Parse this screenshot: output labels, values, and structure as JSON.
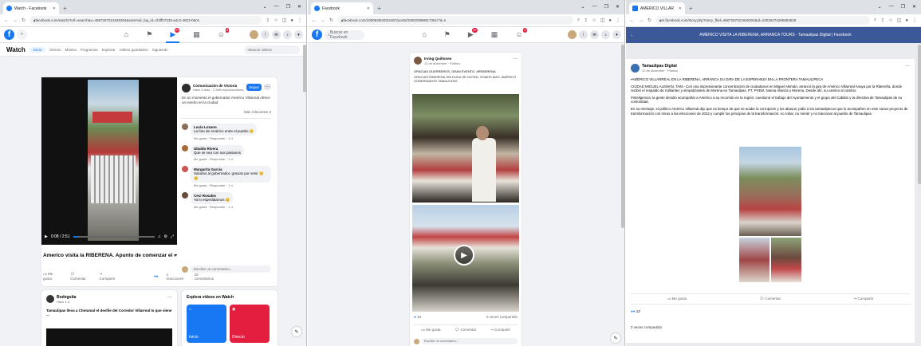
{
  "win1": {
    "tab_title": "Watch - Facebook",
    "url": "facebook.com/watch/?ref=search&v=4587257021846304&external_log_id=1f4ffb7235-a4c2-4823-b9c6",
    "watch_title": "Watch",
    "watch_tabs": [
      "Inicio",
      "Directo",
      "Música",
      "Programas",
      "Explorar",
      "Videos guardados",
      "Siguiendo"
    ],
    "search_placeholder": "Buscar videos",
    "video_time": "0:08 / 2:51",
    "video_title": "Americo visita la RIBERENA. Apunto de comenzar el evento ...",
    "actions": [
      "Me gusta",
      "Comentar",
      "Compartir"
    ],
    "reactions_count": "4 reacciones",
    "comments_count": "20 comentarios",
    "page_name": "Comunicación de Victoria",
    "page_meta": "Hace 5 días · 2 398 reproducciones",
    "follow_label": "Seguir",
    "page_desc": "En un momento el gobernador Américo Villarreal ofrece un evento en la ciudad",
    "sort_label": "Más relevantes",
    "comments": [
      {
        "name": "Lucía Lozano",
        "text": "La foto de Américo entre el pueblo"
      },
      {
        "name": "Ubaldo Rivera",
        "text": "Que se vea con sus paisanos"
      },
      {
        "name": "Margarita García",
        "text": "Saludos al gobernador, gracias por venir"
      },
      {
        "name": "Ceci Rosales",
        "text": "Ya lo esperábamos"
      }
    ],
    "comment_actions": "Me gusta · Responder · 1 d",
    "write_comment": "Escribe un comentario...",
    "post_author": "Bodeguita",
    "post_sub": "Hace 1 d",
    "post_text": "Tamaulipas lleva a Chetumal el desfile del Corredor Villarreal lo que viene ...",
    "explore_title": "Explora videos en Watch",
    "explore_cards": [
      "Inicio",
      "Directo"
    ]
  },
  "win2": {
    "tab_title": "Facebook",
    "url": "facebook.com/100063504022467/posts/329020989917381/?d=n",
    "search_placeholder": "Buscar en Facebook",
    "post_author": "Irving Quiñones",
    "post_meta": "12 de diciembre · Público",
    "post_caption": "GRACIAS GUERREROS, GRAN EVENTO. #REBERENA",
    "post_text": "GRACIAS RIBERENA SIN DUDA SE NOTAN, SOMOS MAS, AMÉRICO GOBERNADOR TAMAULIPAS",
    "reactions": "19",
    "shares": "3 veces compartido",
    "actions": [
      "Me gusta",
      "Comentar",
      "Compartir"
    ],
    "write_comment": "Escribe un comentario..."
  },
  "win3": {
    "tab_title": "AMERICO VILLARREAL ANAYA",
    "url": "m.facebook.com/story.php?story_fbid=4587257021846304&id=10026374295853628",
    "banner": "AMÉRICO VISITA LA RIBERENA, ARRANCA TOURS - Tamaulipas Digital | Facebook",
    "page_name": "Tamaulipas Digital",
    "page_meta": "12 de diciembre · Público",
    "p1": "•AMÉRICO VILLARREAL EN LA RIBERENA, ARRANCA SU GIRA DE LA ESPERANZA EN LA FRONTERA TAMAULIPECA",
    "p2": "CIUDAD MIGUEL ALEMÁN, TAM.- Con una impresionante concentración de ciudadanos en Miguel Alemán, arrancó la gira de Américo Villarreal Anaya por la Ribereña, donde recibió el respaldo de militantes y simpatizantes de Morena en Tamaulipas. PT, PVEM, Nueva Alianza y Morena. Desde ahí, su camino al cambio.",
    "p3": "#Inteligencia: la gente decidió acompañar a Américo a su recorrido en la región: cuestionó el trabajo del Ayuntamiento y el grupo del Cabildo y la directiva de Tamaulipas de su comunidad.",
    "p4": "En su mensaje, el político Américo Villarreal dijo que es tiempo de que se acabe la corrupción y los abusos; pidió a los tamaulipecos que lo acompañen en este nuevo proyecto de transformación con miras a las elecciones de 2022 y cumplir los principios de la transformación: no robar, no mentir y no traicionar al pueblo de Tamaulipas.",
    "actions": [
      "Me gusta",
      "Comentar",
      "Compartir"
    ],
    "reactions": "13",
    "shares": "3 veces compartido"
  },
  "colors": {
    "fb_blue": "#1877f2",
    "tab_bg": "#dee1e6",
    "page_bg": "#f0f2f5",
    "banner": "#3b5998",
    "red": "#e41e3f"
  }
}
